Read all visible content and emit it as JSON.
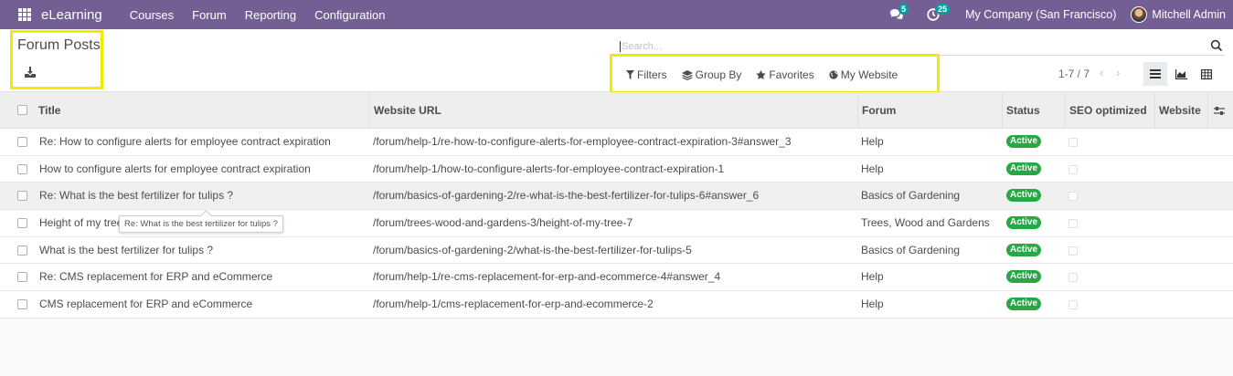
{
  "navbar": {
    "brand": "eLearning",
    "menu": [
      "Courses",
      "Forum",
      "Reporting",
      "Configuration"
    ],
    "messages_count": "5",
    "activities_count": "25",
    "company": "My Company (San Francisco)",
    "user": "Mitchell Admin",
    "bg_color": "#735f93"
  },
  "control_panel": {
    "title": "Forum Posts",
    "search_placeholder": "Search...",
    "filters": [
      "Filters",
      "Group By",
      "Favorites",
      "My Website"
    ],
    "pager": "1-7 / 7"
  },
  "table": {
    "columns": [
      "Title",
      "Website URL",
      "Forum",
      "Status",
      "SEO optimized",
      "Website"
    ],
    "rows": [
      {
        "title": "Re: How to configure alerts for employee contract expiration",
        "url": "/forum/help-1/re-how-to-configure-alerts-for-employee-contract-expiration-3#answer_3",
        "forum": "Help",
        "status": "Active"
      },
      {
        "title": "How to configure alerts for employee contract expiration",
        "url": "/forum/help-1/how-to-configure-alerts-for-employee-contract-expiration-1",
        "forum": "Help",
        "status": "Active"
      },
      {
        "title": "Re: What is the best fertilizer for tulips ?",
        "url": "/forum/basics-of-gardening-2/re-what-is-the-best-fertilizer-for-tulips-6#answer_6",
        "forum": "Basics of Gardening",
        "status": "Active"
      },
      {
        "title": "Height of my tree",
        "url": "/forum/trees-wood-and-gardens-3/height-of-my-tree-7",
        "forum": "Trees, Wood and Gardens",
        "status": "Active"
      },
      {
        "title": "What is the best fertilizer for tulips ?",
        "url": "/forum/basics-of-gardening-2/what-is-the-best-fertilizer-for-tulips-5",
        "forum": "Basics of Gardening",
        "status": "Active"
      },
      {
        "title": "Re: CMS replacement for ERP and eCommerce",
        "url": "/forum/help-1/re-cms-replacement-for-erp-and-ecommerce-4#answer_4",
        "forum": "Help",
        "status": "Active"
      },
      {
        "title": "CMS replacement for ERP and eCommerce",
        "url": "/forum/help-1/cms-replacement-for-erp-and-ecommerce-2",
        "forum": "Help",
        "status": "Active"
      }
    ],
    "tooltip": "Re: What is the best fertilizer for tulips ?",
    "status_color": "#28a745"
  }
}
